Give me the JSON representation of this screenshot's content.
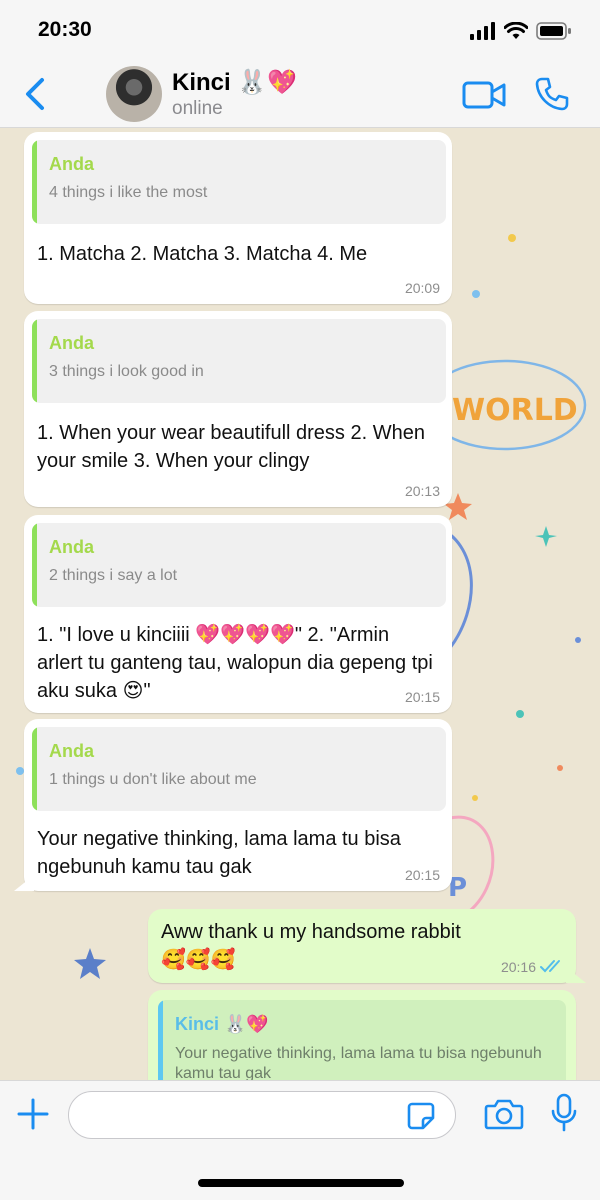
{
  "status_bar": {
    "time": "20:30"
  },
  "header": {
    "contact_name": "Kinci 🐰💖",
    "contact_status": "online"
  },
  "messages": [
    {
      "direction": "in",
      "quote_author": "Anda",
      "quote_text": "4 things i like the most",
      "text": "1. Matcha 2. Matcha 3. Matcha 4. Me",
      "time": "20:09"
    },
    {
      "direction": "in",
      "quote_author": "Anda",
      "quote_text": "3 things i look good in",
      "text": "1. When your wear beautifull dress 2. When your smile 3. When your clingy",
      "time": "20:13"
    },
    {
      "direction": "in",
      "quote_author": "Anda",
      "quote_text": "2 things i say a lot",
      "text": "1. \"I love u kinciiii 💖💖💖💖\" 2. \"Armin arlert tu ganteng tau, walopun dia gepeng tpi aku suka 😍\"",
      "time": "20:15"
    },
    {
      "direction": "in",
      "quote_author": "Anda",
      "quote_text": "1 things u don't like about me",
      "text": "Your negative thinking, lama lama tu bisa ngebunuh kamu tau gak",
      "time": "20:15"
    },
    {
      "direction": "out",
      "text": "Aww thank u my handsome rabbit 🥰🥰🥰",
      "time": "20:16",
      "read_receipt": "double-check-blue"
    },
    {
      "direction": "out",
      "quote_author": "Kinci 🐰💖",
      "quote_text": "Your negative thinking, lama lama tu bisa ngebunuh kamu tau gak"
    }
  ],
  "wallpaper_text": "WORLD",
  "input": {
    "placeholder": ""
  },
  "colors": {
    "accent_blue": "#1a8cf0",
    "quote_author_in": "#a4d94c",
    "quote_author_out": "#59bde8",
    "outgoing_bubble": "#e2fcc9",
    "read_tick": "#53bdeb"
  }
}
